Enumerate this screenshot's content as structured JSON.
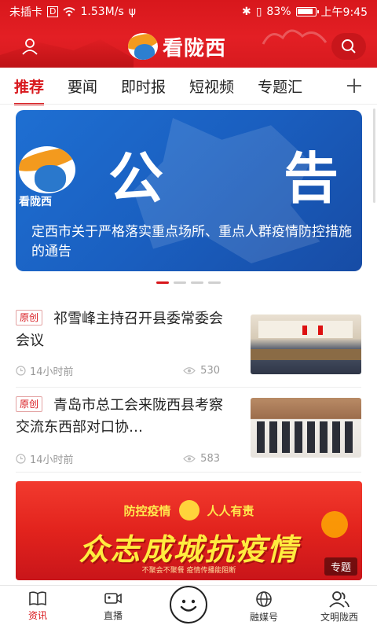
{
  "statusbar": {
    "carrier": "未插卡",
    "speed": "1.53M/s",
    "battery": "83%",
    "time": "上午9:45"
  },
  "header": {
    "logo_text": "看陇西"
  },
  "tabs": [
    {
      "label": "推荐",
      "active": true
    },
    {
      "label": "要闻"
    },
    {
      "label": "即时报"
    },
    {
      "label": "短视频"
    },
    {
      "label": "专题汇"
    }
  ],
  "banner": {
    "badge_label": "看陇西",
    "notice_left": "公",
    "notice_right": "告",
    "caption": "定西市关于严格落实重点场所、重点人群疫情防控措施的通告",
    "dots": 4,
    "active_dot": 0
  },
  "news": [
    {
      "tag": "原创",
      "title": "祁雪峰主持召开县委常委会会议",
      "time": "14小时前",
      "views": "530"
    },
    {
      "tag": "原创",
      "title": "青岛市总工会来陇西县考察交流东西部对口协…",
      "time": "14小时前",
      "views": "583"
    }
  ],
  "promo": {
    "slogan_left": "防控疫情",
    "slogan_right": "人人有责",
    "headline": "众志成城抗疫情",
    "note": "不聚会不聚餐 疫情传播能阻断",
    "badge": "专题"
  },
  "tabbar": [
    {
      "label": "资讯",
      "icon": "book-icon",
      "active": true
    },
    {
      "label": "直播",
      "icon": "video-camera-icon"
    },
    {
      "label": "",
      "icon": "smile-icon"
    },
    {
      "label": "融媒号",
      "icon": "globe-icon"
    },
    {
      "label": "文明陇西",
      "icon": "people-icon"
    }
  ],
  "colors": {
    "brand_red": "#d8171c",
    "banner_blue": "#1a5fc0"
  }
}
